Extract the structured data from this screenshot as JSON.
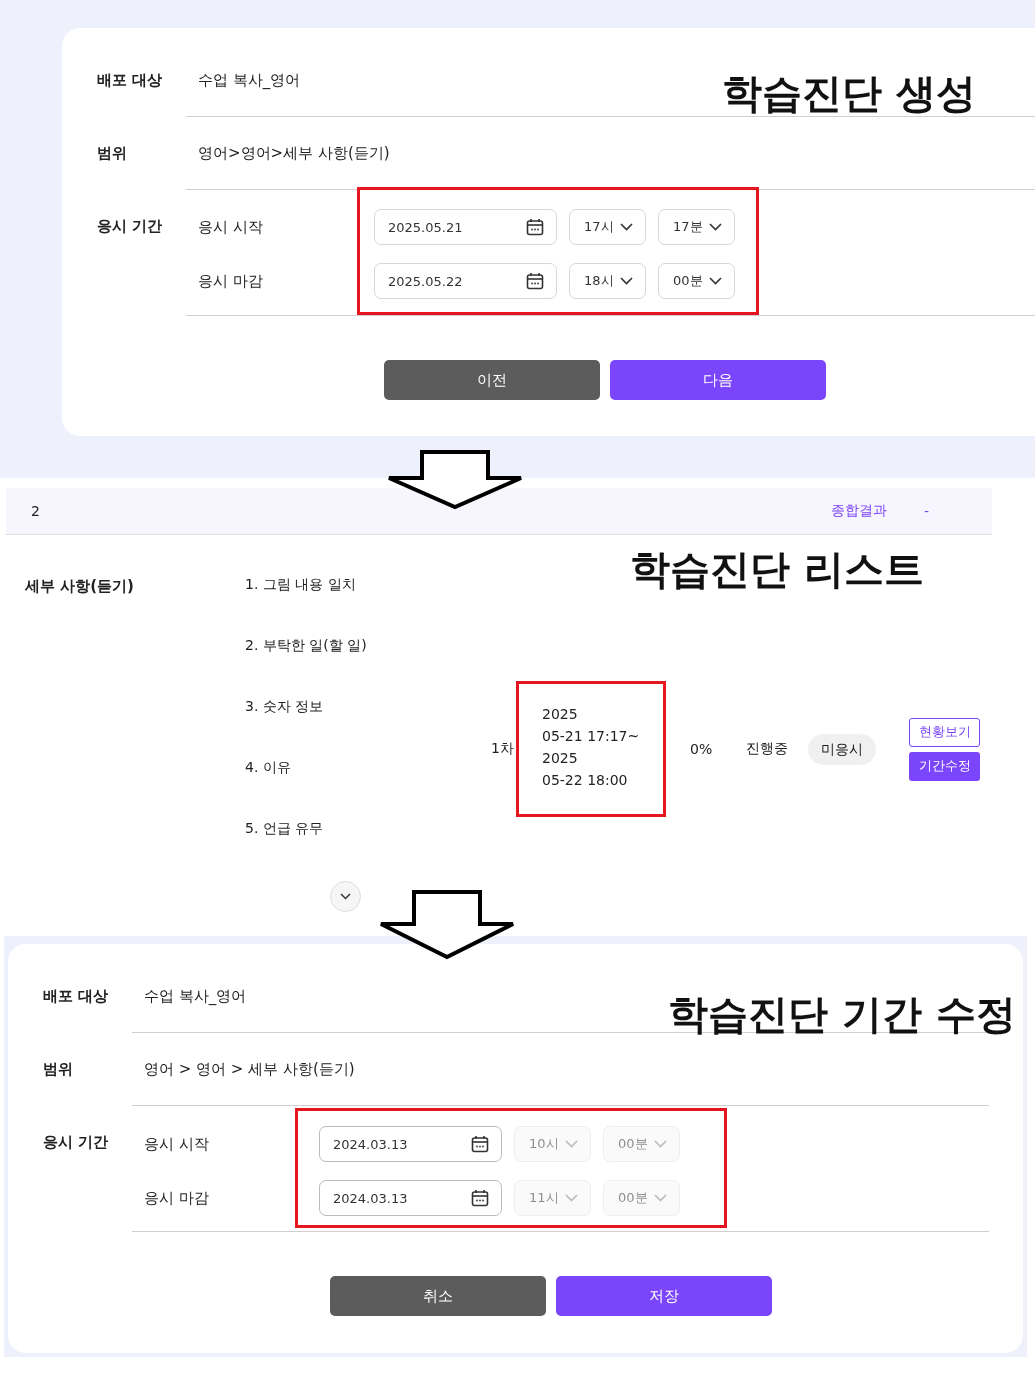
{
  "sections": [
    {
      "kind": "form",
      "annotation": "학습진단 생성",
      "fields": [
        {
          "label": "배포 대상",
          "value": "수업 복사_영어"
        },
        {
          "label": "범위",
          "value": "영어>영어>세부 사항(듣기)"
        }
      ],
      "period": {
        "label": "응시 기간",
        "rows": [
          {
            "label": "응시 시작",
            "date": "2025.05.21",
            "hour": {
              "value": "17시",
              "disabled": false
            },
            "minute": {
              "value": "17분",
              "disabled": false
            }
          },
          {
            "label": "응시 마감",
            "date": "2025.05.22",
            "hour": {
              "value": "18시",
              "disabled": false
            },
            "minute": {
              "value": "00분",
              "disabled": false
            }
          }
        ]
      },
      "buttons": [
        {
          "label": "이전",
          "kind": "secondary"
        },
        {
          "label": "다음",
          "kind": "primary"
        }
      ]
    },
    {
      "kind": "list",
      "annotation": "학습진단 리스트",
      "header": {
        "number": "2",
        "result_link": "종합결과",
        "score": "-"
      },
      "row": {
        "category": "세부 사항(듣기)",
        "items": [
          "1. 그림 내용 일치",
          "2. 부탁한 일(할 일)",
          "3. 숫자 정보",
          "4. 이유",
          "5. 언급 유무"
        ],
        "round": "1차",
        "period": "2025\n05-21 17:17~\n2025\n05-22 18:00",
        "progress": "0%",
        "status": "진행중",
        "badge": "미응시",
        "buttons": [
          {
            "label": "현황보기",
            "kind": "outline"
          },
          {
            "label": "기간수정",
            "kind": "primary"
          }
        ]
      }
    },
    {
      "kind": "form",
      "annotation": "학습진단 기간 수정",
      "fields": [
        {
          "label": "배포 대상",
          "value": "수업 복사_영어"
        },
        {
          "label": "범위",
          "value": "영어 > 영어 > 세부 사항(듣기)"
        }
      ],
      "period": {
        "label": "응시 기간",
        "rows": [
          {
            "label": "응시 시작",
            "date": "2024.03.13",
            "hour": {
              "value": "10시",
              "disabled": true
            },
            "minute": {
              "value": "00분",
              "disabled": true
            }
          },
          {
            "label": "응시 마감",
            "date": "2024.03.13",
            "hour": {
              "value": "11시",
              "disabled": true
            },
            "minute": {
              "value": "00분",
              "disabled": true
            }
          }
        ]
      },
      "buttons": [
        {
          "label": "취소",
          "kind": "secondary"
        },
        {
          "label": "저장",
          "kind": "primary"
        }
      ]
    }
  ]
}
